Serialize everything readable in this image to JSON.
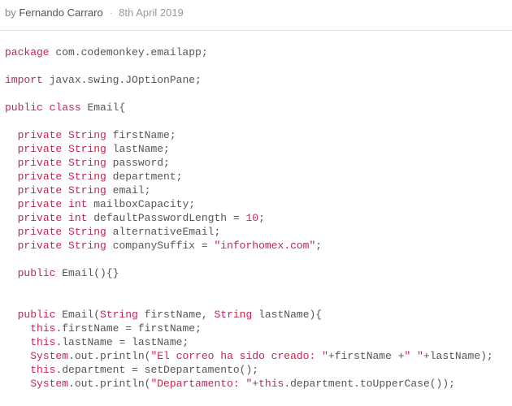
{
  "meta": {
    "by": "by",
    "author": "Fernando Carraro",
    "dot": "·",
    "date": "8th April 2019"
  },
  "code": {
    "l1_kw": "package",
    "l1_rest": " com.codemonkey.emailapp;",
    "l2_kw": "import",
    "l2_rest": " javax.swing.JOptionPane;",
    "l3_kw1": "public",
    "l3_kw2": "class",
    "l3_rest": " Email{",
    "f_kw": "private",
    "f_str": "String",
    "f_int": "int",
    "f1": " firstName;",
    "f2": " lastName;",
    "f3": " password;",
    "f4": " department;",
    "f5": " email;",
    "f6": " mailboxCapacity;",
    "f7a": " defaultPasswordLength = ",
    "f7n": "10",
    "f7b": ";",
    "f8": " alternativeEmail;",
    "f9a": " companySuffix = ",
    "f9s": "\"inforhomex.com\"",
    "f9b": ";",
    "ctor0_kw": "public",
    "ctor0_rest": " Email(){}",
    "ctor1_kw": "public",
    "ctor1_a": " Email(",
    "ctor1_t": "String",
    "ctor1_b": " firstName, ",
    "ctor1_t2": "String",
    "ctor1_c": " lastName){",
    "b_this": "this",
    "b1": ".firstName = firstName;",
    "b2": ".lastName = lastName;",
    "b_sys": "System",
    "b3a": ".out.println(",
    "b3s": "\"El correo ha sido creado: \"",
    "b3b": "+firstName +",
    "b3s2": "\" \"",
    "b3c": "+lastName);",
    "b4": ".department = setDepartamento();",
    "b5a": ".out.println(",
    "b5s": "\"Departamento: \"",
    "b5b": "+",
    "b5c": ".department.toUpperCase());"
  }
}
